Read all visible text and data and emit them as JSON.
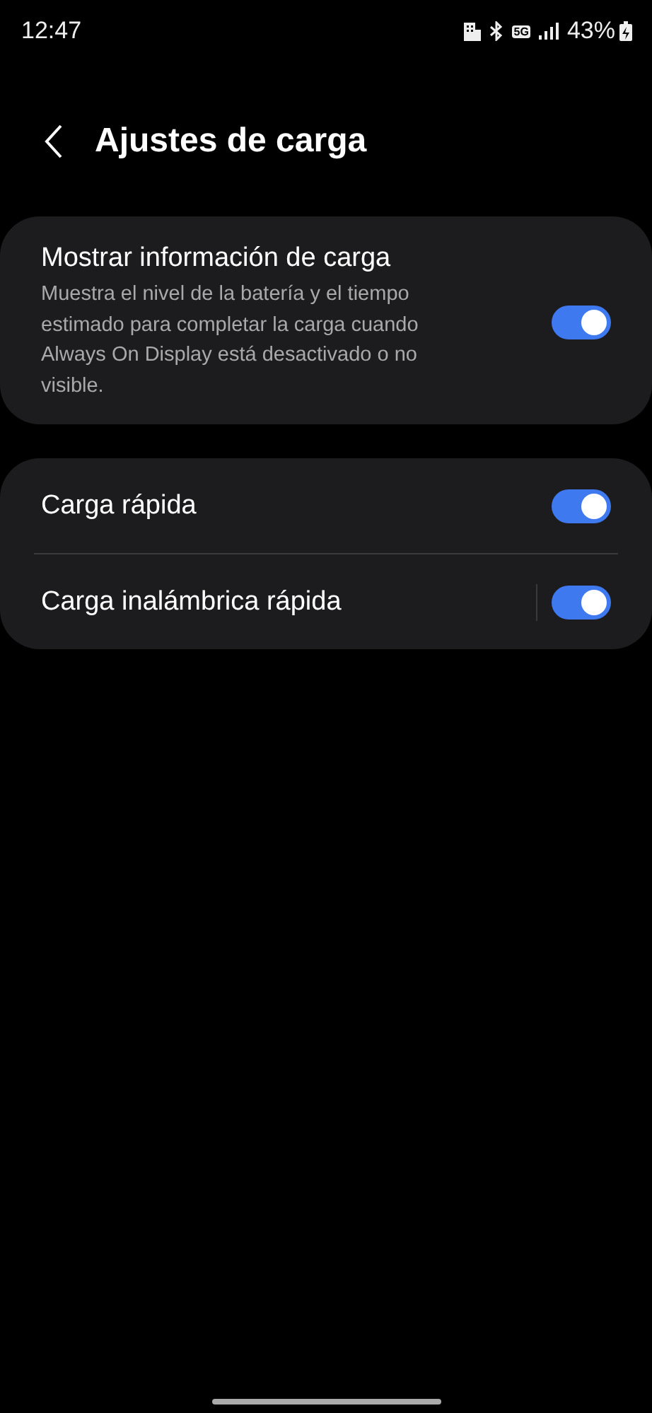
{
  "status_bar": {
    "time": "12:47",
    "network": "5G",
    "battery": "43%"
  },
  "header": {
    "title": "Ajustes de carga"
  },
  "groups": [
    {
      "items": [
        {
          "title": "Mostrar información de carga",
          "description": "Muestra el nivel de la batería y el tiempo estimado para completar la carga cuando Always On Display está desactivado o no visible.",
          "on": true,
          "separated": false
        }
      ]
    },
    {
      "items": [
        {
          "title": "Carga rápida",
          "on": true,
          "separated": false
        },
        {
          "title": "Carga inalámbrica rápida",
          "on": true,
          "separated": true
        }
      ]
    }
  ]
}
